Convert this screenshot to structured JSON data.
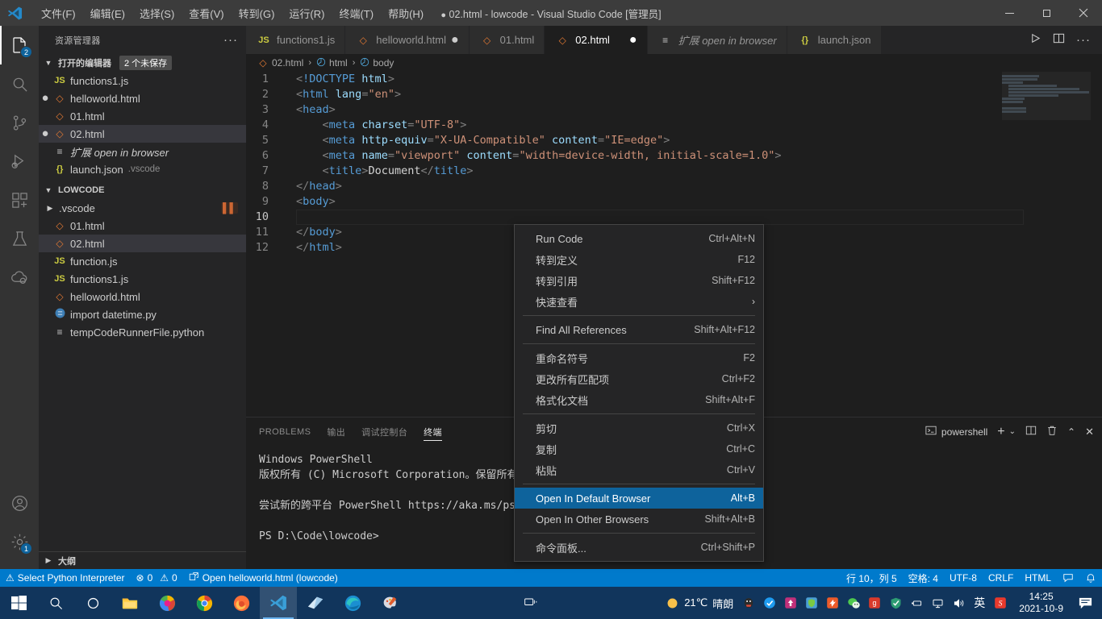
{
  "titlebar": {
    "menus": [
      "文件(F)",
      "编辑(E)",
      "选择(S)",
      "查看(V)",
      "转到(G)",
      "运行(R)",
      "终端(T)",
      "帮助(H)"
    ],
    "title": "02.html - lowcode - Visual Studio Code [管理员]",
    "dirty_dot": "●",
    "minimize": "—",
    "maximize": "❐",
    "close": "✕"
  },
  "activitybar": {
    "items": [
      {
        "name": "explorer",
        "badge": "2"
      },
      {
        "name": "search",
        "badge": ""
      },
      {
        "name": "source-control",
        "badge": ""
      },
      {
        "name": "run-and-debug",
        "badge": ""
      },
      {
        "name": "extensions",
        "badge": ""
      },
      {
        "name": "testing",
        "badge": ""
      },
      {
        "name": "remote-explorer",
        "badge": ""
      }
    ],
    "accounts": "accounts",
    "settings_badge": "1"
  },
  "sidebar": {
    "header": "资源管理器",
    "more": "···",
    "open_editors": {
      "label": "打开的编辑器",
      "pill": "2 个未保存",
      "items": [
        {
          "icon": "js",
          "glyph": "JS",
          "name": "functions1.js",
          "dirty": false,
          "selected": false,
          "desc": ""
        },
        {
          "icon": "html",
          "glyph": "◇",
          "name": "helloworld.html",
          "dirty": true,
          "selected": false,
          "desc": ""
        },
        {
          "icon": "html",
          "glyph": "◇",
          "name": "01.html",
          "dirty": false,
          "selected": false,
          "desc": ""
        },
        {
          "icon": "html",
          "glyph": "◇",
          "name": "02.html",
          "dirty": true,
          "selected": true,
          "desc": ""
        },
        {
          "icon": "list",
          "glyph": "≡",
          "name": "扩展 open in browser",
          "dirty": false,
          "selected": false,
          "desc": "",
          "italic": true
        },
        {
          "icon": "json",
          "glyph": "{}",
          "name": "launch.json",
          "dirty": false,
          "selected": false,
          "desc": ".vscode"
        }
      ]
    },
    "workspace": {
      "label": "LOWCODE",
      "items": [
        {
          "icon": "folder",
          "glyph": "",
          "name": ".vscode",
          "folder": true,
          "selected": false,
          "marker": "▌▌"
        },
        {
          "icon": "html",
          "glyph": "◇",
          "name": "01.html",
          "folder": false,
          "selected": false
        },
        {
          "icon": "html",
          "glyph": "◇",
          "name": "02.html",
          "folder": false,
          "selected": true
        },
        {
          "icon": "js",
          "glyph": "JS",
          "name": "function.js",
          "folder": false,
          "selected": false
        },
        {
          "icon": "js",
          "glyph": "JS",
          "name": "functions1.js",
          "folder": false,
          "selected": false
        },
        {
          "icon": "html",
          "glyph": "◇",
          "name": "helloworld.html",
          "folder": false,
          "selected": false
        },
        {
          "icon": "py",
          "glyph": "●",
          "name": "import datetime.py",
          "folder": false,
          "selected": false
        },
        {
          "icon": "list",
          "glyph": "≡",
          "name": "tempCodeRunnerFile.python",
          "folder": false,
          "selected": false
        }
      ]
    },
    "outline": "大纲"
  },
  "tabs": [
    {
      "label": "functions1.js",
      "icon": "js",
      "glyph": "JS",
      "active": false,
      "dirty": false
    },
    {
      "label": "helloworld.html",
      "icon": "html",
      "glyph": "◇",
      "active": false,
      "dirty": true
    },
    {
      "label": "01.html",
      "icon": "html",
      "glyph": "◇",
      "active": false,
      "dirty": false
    },
    {
      "label": "02.html",
      "icon": "html",
      "glyph": "◇",
      "active": true,
      "dirty": true
    },
    {
      "label": "扩展 open in browser",
      "icon": "list",
      "glyph": "≡",
      "active": false,
      "dirty": false,
      "italic": true
    },
    {
      "label": "launch.json",
      "icon": "json",
      "glyph": "{}",
      "active": false,
      "dirty": false
    }
  ],
  "tab_actions": {
    "run": "▷",
    "split": "▣",
    "more": "···"
  },
  "breadcrumb": {
    "file": "02.html",
    "parts": [
      "html",
      "body"
    ],
    "sep": "›"
  },
  "editor": {
    "lines": [
      {
        "n": "1",
        "text": "<!DOCTYPE html>"
      },
      {
        "n": "2",
        "text": "<html lang=\"en\">"
      },
      {
        "n": "3",
        "text": "<head>"
      },
      {
        "n": "4",
        "text": "    <meta charset=\"UTF-8\">"
      },
      {
        "n": "5",
        "text": "    <meta http-equiv=\"X-UA-Compatible\" content=\"IE=edge\">"
      },
      {
        "n": "6",
        "text": "    <meta name=\"viewport\" content=\"width=device-width, initial-scale=1.0\">"
      },
      {
        "n": "7",
        "text": "    <title>Document</title>"
      },
      {
        "n": "8",
        "text": "</head>"
      },
      {
        "n": "9",
        "text": "<body>"
      },
      {
        "n": "10",
        "text": "    "
      },
      {
        "n": "11",
        "text": "</body>"
      },
      {
        "n": "12",
        "text": "</html>"
      }
    ],
    "current_line": "10"
  },
  "contextmenu": {
    "groups": [
      [
        {
          "label": "Run Code",
          "key": "Ctrl+Alt+N",
          "highlight": false,
          "submenu": false
        },
        {
          "label": "转到定义",
          "key": "F12",
          "highlight": false,
          "submenu": false
        },
        {
          "label": "转到引用",
          "key": "Shift+F12",
          "highlight": false,
          "submenu": false
        },
        {
          "label": "快速查看",
          "key": "",
          "highlight": false,
          "submenu": true
        }
      ],
      [
        {
          "label": "Find All References",
          "key": "Shift+Alt+F12",
          "highlight": false,
          "submenu": false
        }
      ],
      [
        {
          "label": "重命名符号",
          "key": "F2",
          "highlight": false,
          "submenu": false
        },
        {
          "label": "更改所有匹配项",
          "key": "Ctrl+F2",
          "highlight": false,
          "submenu": false
        },
        {
          "label": "格式化文档",
          "key": "Shift+Alt+F",
          "highlight": false,
          "submenu": false
        }
      ],
      [
        {
          "label": "剪切",
          "key": "Ctrl+X",
          "highlight": false,
          "submenu": false
        },
        {
          "label": "复制",
          "key": "Ctrl+C",
          "highlight": false,
          "submenu": false
        },
        {
          "label": "粘贴",
          "key": "Ctrl+V",
          "highlight": false,
          "submenu": false
        }
      ],
      [
        {
          "label": "Open In Default Browser",
          "key": "Alt+B",
          "highlight": true,
          "submenu": false
        },
        {
          "label": "Open In Other Browsers",
          "key": "Shift+Alt+B",
          "highlight": false,
          "submenu": false
        }
      ],
      [
        {
          "label": "命令面板...",
          "key": "Ctrl+Shift+P",
          "highlight": false,
          "submenu": false
        }
      ]
    ],
    "submenu_arrow": "›"
  },
  "panel": {
    "tabs": [
      {
        "label": "PROBLEMS",
        "active": false
      },
      {
        "label": "输出",
        "active": false
      },
      {
        "label": "调试控制台",
        "active": false
      },
      {
        "label": "终端",
        "active": true
      }
    ],
    "terminal_name": "powershell",
    "actions": {
      "add": "+",
      "chevron": "⌄",
      "split": "▯▯",
      "trash": "🗑",
      "collapse": "⌃",
      "close": "✕"
    },
    "content": "Windows PowerShell\n版权所有 (C) Microsoft Corporation。保留所有权\n\n尝试新的跨平台 PowerShell https://aka.ms/pscc\n\nPS D:\\Code\\lowcode> "
  },
  "statusbar": {
    "left": [
      {
        "icon": "warning-triangle",
        "glyph": "⚠",
        "label": "Select Python Interpreter"
      },
      {
        "icon": "error-circle",
        "glyph": "⊗",
        "label": "0"
      },
      {
        "icon": "warning-triangle",
        "glyph": "⚠",
        "label": "0"
      },
      {
        "icon": "open-preview",
        "glyph": "⎙",
        "label": "Open helloworld.html (lowcode)"
      }
    ],
    "right": [
      {
        "icon": "",
        "glyph": "",
        "label": "行 10，列 5"
      },
      {
        "icon": "",
        "glyph": "",
        "label": "空格: 4"
      },
      {
        "icon": "",
        "glyph": "",
        "label": "UTF-8"
      },
      {
        "icon": "",
        "glyph": "",
        "label": "CRLF"
      },
      {
        "icon": "",
        "glyph": "",
        "label": "HTML"
      },
      {
        "icon": "feedback-icon",
        "glyph": "☍",
        "label": ""
      },
      {
        "icon": "bell-icon",
        "glyph": "🔔",
        "label": ""
      }
    ]
  },
  "taskbar": {
    "apps": [
      {
        "name": "start-button",
        "active": false
      },
      {
        "name": "search-button",
        "active": false
      },
      {
        "name": "cortana-button",
        "active": false
      },
      {
        "name": "file-explorer",
        "active": false
      },
      {
        "name": "chrome-canary",
        "active": false
      },
      {
        "name": "google-chrome",
        "active": false
      },
      {
        "name": "firefox",
        "active": false
      },
      {
        "name": "visual-studio-code",
        "active": true
      },
      {
        "name": "windows-terminal",
        "active": false
      },
      {
        "name": "microsoft-edge",
        "active": false
      },
      {
        "name": "paint-3d",
        "active": false
      }
    ],
    "taskview": "taskview-icon",
    "weather": {
      "temp": "21℃",
      "desc": "晴朗"
    },
    "tray": [
      "qq-icon",
      "safety-icon",
      "upload-icon",
      "green-shield-icon",
      "orange-icon",
      "wechat-icon",
      "wps-icon",
      "defender-icon",
      "usb-icon",
      "network-icon",
      "volume-icon"
    ],
    "ime": "英",
    "sogou": "S",
    "time": "14:25",
    "date": "2021-10-9",
    "notification": "notification-icon"
  },
  "colors": {
    "accent": "#007acc",
    "menu_highlight": "#0e639c",
    "titlebar": "#3c3c3c",
    "sidebar": "#252526",
    "editor": "#1e1e1e",
    "activitybar": "#333333",
    "taskbar": "#11355c"
  }
}
